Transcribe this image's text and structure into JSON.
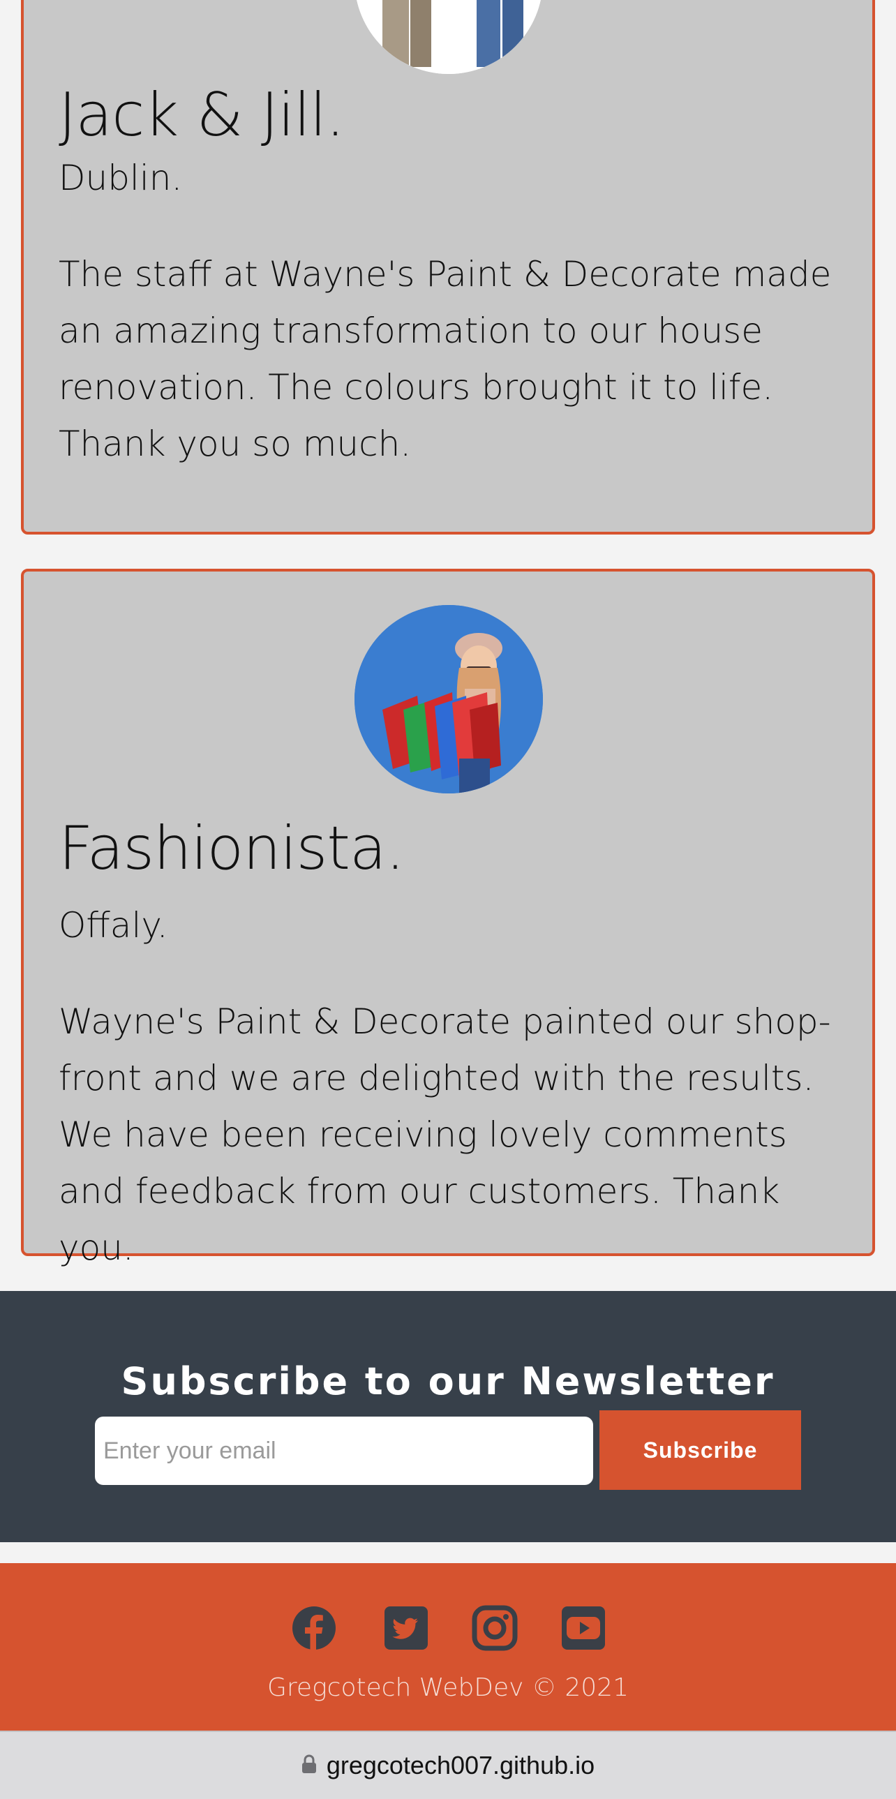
{
  "testimonials": [
    {
      "name": "Jack & Jill.",
      "location": "Dublin.",
      "quote": "The staff at Wayne's Paint & Decorate made an amazing transformation to our house renovation. The colours brought it to life. Thank you so much.",
      "avatar_icon": "couple-photo"
    },
    {
      "name": "Fashionista.",
      "location": "Offaly.",
      "quote": "Wayne's Paint & Decorate painted our shop-front and we are delighted with the results. We have been receiving lovely comments and feedback from our customers. Thank you.",
      "avatar_icon": "shopper-photo"
    }
  ],
  "newsletter": {
    "title": "Subscribe to our Newsletter",
    "email_placeholder": "Enter your email",
    "email_value": "",
    "button_label": "Subscribe"
  },
  "footer": {
    "social_icons": [
      "facebook-icon",
      "twitter-icon",
      "instagram-icon",
      "youtube-icon"
    ],
    "copyright": "Gregcotech WebDev © 2021"
  },
  "browser": {
    "url": "gregcotech007.github.io",
    "lock_icon": "lock-icon"
  },
  "colors": {
    "accent": "#d6532f",
    "card_background": "#c8c8c8",
    "newsletter_background": "#37404a",
    "page_background": "#f3f3f3",
    "icon_color": "#3a3f47"
  }
}
